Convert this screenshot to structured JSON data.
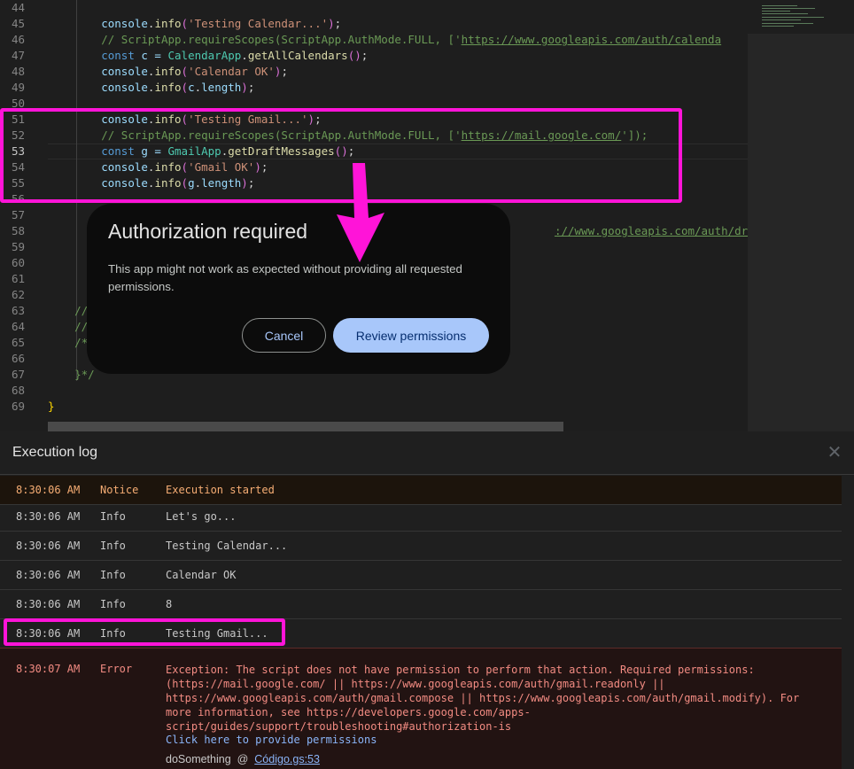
{
  "editor": {
    "lines": [
      {
        "n": "44",
        "segs": []
      },
      {
        "n": "45",
        "segs": [
          {
            "t": "        ",
            "c": "t-p"
          },
          {
            "t": "console",
            "c": "t-obj"
          },
          {
            "t": ".",
            "c": "t-p"
          },
          {
            "t": "info",
            "c": "t-fn"
          },
          {
            "t": "(",
            "c": "t-br"
          },
          {
            "t": "'Testing Calendar...'",
            "c": "t-str"
          },
          {
            "t": ")",
            "c": "t-br"
          },
          {
            "t": ";",
            "c": "t-p"
          }
        ]
      },
      {
        "n": "46",
        "segs": [
          {
            "t": "        ",
            "c": "t-p"
          },
          {
            "t": "// ScriptApp.requireScopes(ScriptApp.AuthMode.FULL, ['",
            "c": "t-cmt"
          },
          {
            "t": "https://www.googleapis.com/auth/calenda",
            "c": "t-link"
          }
        ]
      },
      {
        "n": "47",
        "segs": [
          {
            "t": "        ",
            "c": "t-p"
          },
          {
            "t": "const",
            "c": "t-kw"
          },
          {
            "t": " c = ",
            "c": "t-obj"
          },
          {
            "t": "CalendarApp",
            "c": "t-cls"
          },
          {
            "t": ".",
            "c": "t-p"
          },
          {
            "t": "getAllCalendars",
            "c": "t-fn"
          },
          {
            "t": "()",
            "c": "t-br"
          },
          {
            "t": ";",
            "c": "t-p"
          }
        ]
      },
      {
        "n": "48",
        "segs": [
          {
            "t": "        ",
            "c": "t-p"
          },
          {
            "t": "console",
            "c": "t-obj"
          },
          {
            "t": ".",
            "c": "t-p"
          },
          {
            "t": "info",
            "c": "t-fn"
          },
          {
            "t": "(",
            "c": "t-br"
          },
          {
            "t": "'Calendar OK'",
            "c": "t-str"
          },
          {
            "t": ")",
            "c": "t-br"
          },
          {
            "t": ";",
            "c": "t-p"
          }
        ]
      },
      {
        "n": "49",
        "segs": [
          {
            "t": "        ",
            "c": "t-p"
          },
          {
            "t": "console",
            "c": "t-obj"
          },
          {
            "t": ".",
            "c": "t-p"
          },
          {
            "t": "info",
            "c": "t-fn"
          },
          {
            "t": "(",
            "c": "t-br"
          },
          {
            "t": "c",
            "c": "t-obj"
          },
          {
            "t": ".",
            "c": "t-p"
          },
          {
            "t": "length",
            "c": "t-obj"
          },
          {
            "t": ")",
            "c": "t-br"
          },
          {
            "t": ";",
            "c": "t-p"
          }
        ]
      },
      {
        "n": "50",
        "segs": []
      },
      {
        "n": "51",
        "segs": [
          {
            "t": "        ",
            "c": "t-p"
          },
          {
            "t": "console",
            "c": "t-obj"
          },
          {
            "t": ".",
            "c": "t-p"
          },
          {
            "t": "info",
            "c": "t-fn"
          },
          {
            "t": "(",
            "c": "t-br"
          },
          {
            "t": "'Testing Gmail...'",
            "c": "t-str"
          },
          {
            "t": ")",
            "c": "t-br"
          },
          {
            "t": ";",
            "c": "t-p"
          }
        ]
      },
      {
        "n": "52",
        "segs": [
          {
            "t": "        ",
            "c": "t-p"
          },
          {
            "t": "// ScriptApp.requireScopes(ScriptApp.AuthMode.FULL, ['",
            "c": "t-cmt"
          },
          {
            "t": "https://mail.google.com/",
            "c": "t-link"
          },
          {
            "t": "']);",
            "c": "t-cmt"
          }
        ]
      },
      {
        "n": "53",
        "segs": [
          {
            "t": "        ",
            "c": "t-p"
          },
          {
            "t": "const",
            "c": "t-kw"
          },
          {
            "t": " g = ",
            "c": "t-obj"
          },
          {
            "t": "GmailApp",
            "c": "t-cls"
          },
          {
            "t": ".",
            "c": "t-p"
          },
          {
            "t": "getDraftMessages",
            "c": "t-fn"
          },
          {
            "t": "()",
            "c": "t-br"
          },
          {
            "t": ";",
            "c": "t-p"
          }
        ]
      },
      {
        "n": "54",
        "segs": [
          {
            "t": "        ",
            "c": "t-p"
          },
          {
            "t": "console",
            "c": "t-obj"
          },
          {
            "t": ".",
            "c": "t-p"
          },
          {
            "t": "info",
            "c": "t-fn"
          },
          {
            "t": "(",
            "c": "t-br"
          },
          {
            "t": "'Gmail OK'",
            "c": "t-str"
          },
          {
            "t": ")",
            "c": "t-br"
          },
          {
            "t": ";",
            "c": "t-p"
          }
        ]
      },
      {
        "n": "55",
        "segs": [
          {
            "t": "        ",
            "c": "t-p"
          },
          {
            "t": "console",
            "c": "t-obj"
          },
          {
            "t": ".",
            "c": "t-p"
          },
          {
            "t": "info",
            "c": "t-fn"
          },
          {
            "t": "(",
            "c": "t-br"
          },
          {
            "t": "g",
            "c": "t-obj"
          },
          {
            "t": ".",
            "c": "t-p"
          },
          {
            "t": "length",
            "c": "t-obj"
          },
          {
            "t": ")",
            "c": "t-br"
          },
          {
            "t": ";",
            "c": "t-p"
          }
        ]
      },
      {
        "n": "56",
        "segs": []
      },
      {
        "n": "57",
        "segs": []
      },
      {
        "n": "58",
        "segs": [
          {
            "t": "                                                                            ",
            "c": "t-p"
          },
          {
            "t": "://www.googleapis.com/auth/drive.re",
            "c": "t-link"
          }
        ]
      },
      {
        "n": "59",
        "segs": []
      },
      {
        "n": "60",
        "segs": []
      },
      {
        "n": "61",
        "segs": []
      },
      {
        "n": "62",
        "segs": []
      },
      {
        "n": "63",
        "segs": [
          {
            "t": "    ",
            "c": "t-p"
          },
          {
            "t": "//",
            "c": "t-cmt"
          }
        ]
      },
      {
        "n": "64",
        "segs": [
          {
            "t": "    ",
            "c": "t-p"
          },
          {
            "t": "//",
            "c": "t-cmt"
          }
        ]
      },
      {
        "n": "65",
        "segs": [
          {
            "t": "    ",
            "c": "t-p"
          },
          {
            "t": "/*",
            "c": "t-cmt"
          }
        ]
      },
      {
        "n": "66",
        "segs": []
      },
      {
        "n": "67",
        "segs": [
          {
            "t": "    ",
            "c": "t-p"
          },
          {
            "t": "}*/",
            "c": "t-cmt"
          }
        ]
      },
      {
        "n": "68",
        "segs": []
      },
      {
        "n": "69",
        "segs": [
          {
            "t": "}",
            "c": "t-br2"
          }
        ]
      }
    ],
    "active_line": "53"
  },
  "dialog": {
    "title": "Authorization required",
    "body": "This app might not work as expected without providing all requested permissions.",
    "cancel_label": "Cancel",
    "review_label": "Review permissions"
  },
  "log": {
    "title": "Execution log",
    "close_icon": "close-icon",
    "rows": [
      {
        "time": "8:30:06 AM",
        "severity": "Notice",
        "message": "Execution started",
        "kind": "notice"
      },
      {
        "time": "8:30:06 AM",
        "severity": "Info",
        "message": "Let's go...",
        "kind": "info"
      },
      {
        "time": "8:30:06 AM",
        "severity": "Info",
        "message": "Testing Calendar...",
        "kind": "info"
      },
      {
        "time": "8:30:06 AM",
        "severity": "Info",
        "message": "Calendar OK",
        "kind": "info"
      },
      {
        "time": "8:30:06 AM",
        "severity": "Info",
        "message": "8",
        "kind": "info"
      },
      {
        "time": "8:30:06 AM",
        "severity": "Info",
        "message": "Testing Gmail...",
        "kind": "info"
      }
    ],
    "error": {
      "time": "8:30:07 AM",
      "severity": "Error",
      "message": "Exception: The script does not have permission to perform that action. Required permissions:\n(https://mail.google.com/ || https://www.googleapis.com/auth/gmail.readonly ||\nhttps://www.googleapis.com/auth/gmail.compose || https://www.googleapis.com/auth/gmail.modify). For\nmore information, see https://developers.google.com/apps-\nscript/guides/support/troubleshooting#authorization-is",
      "link": "Click here to provide permissions",
      "stack_fn": "doSomething",
      "stack_at": "@",
      "stack_file": "Código.gs:53"
    }
  },
  "colors": {
    "highlight": "#ff14d8",
    "accent_button": "#a8c7fa",
    "error_text": "#f28b82",
    "notice_text": "#f6ad74"
  }
}
